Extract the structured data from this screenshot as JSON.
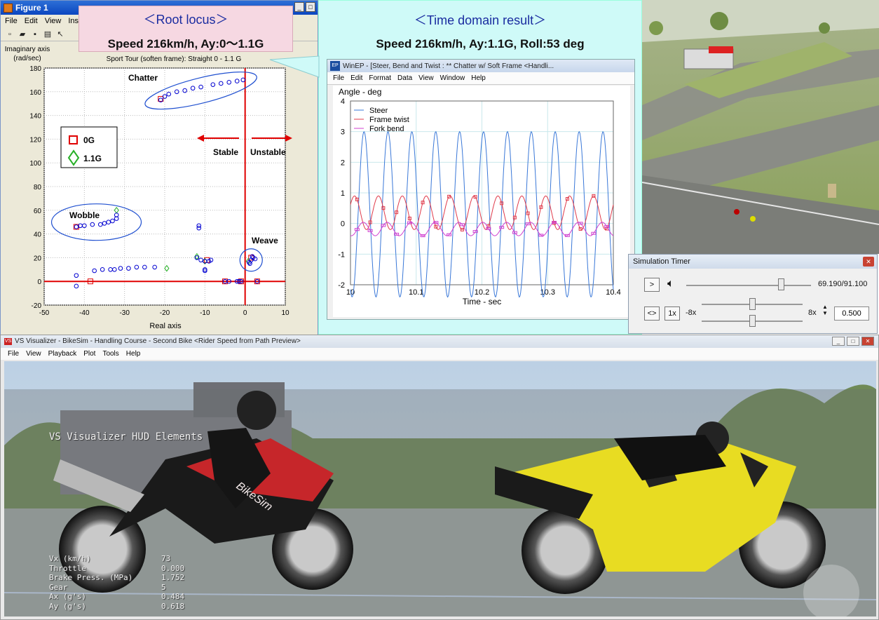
{
  "figure": {
    "title": "Figure 1",
    "menu": [
      "File",
      "Edit",
      "View",
      "Ins"
    ],
    "callout_title": "＜Root locus＞",
    "callout_sub": "Speed 216km/h, Ay:0～1.1G",
    "ylabel_line1": "Imaginary axis",
    "ylabel_line2": "(rad/sec)",
    "plot_title": "Sport Tour (soften frame): Straight 0 - 1.1 G",
    "xlabel": "Real axis",
    "legend": [
      "0G",
      "1.1G"
    ],
    "annotations": {
      "chatter": "Chatter",
      "wobble": "Wobble",
      "weave": "Weave",
      "stable": "Stable",
      "unstable": "Unstable"
    },
    "colors": {
      "mode0G": "#e00000",
      "mode11G": "#28b028",
      "poles": "#0000d0",
      "axis": "#e00000",
      "ellipse": "#2050d0"
    }
  },
  "time_domain": {
    "title": "＜Time domain result＞",
    "subtitle": "Speed 216km/h, Ay:1.1G, Roll:53 deg",
    "window_title": "WinEP - [Steer, Bend and Twist : ** Chatter w/ Soft Frame <Handli...",
    "menu": [
      "File",
      "Edit",
      "Format",
      "Data",
      "View",
      "Window",
      "Help"
    ],
    "ylabel": "Angle - deg",
    "xlabel": "Time - sec",
    "legend": [
      "Steer",
      "Frame twist",
      "Fork bend"
    ],
    "colors": {
      "steer": "#3a78d8",
      "twist": "#e03a4a",
      "fork": "#d040d0"
    }
  },
  "sim_timer": {
    "title": "Simulation Timer",
    "play_label": ">",
    "loop_label": "<>",
    "speed_label": "1x",
    "min_speed": "-8x",
    "max_speed": "8x",
    "time_readout": "69.190/91.100",
    "rate_value": "0.500",
    "time_progress": 0.7595,
    "speed_position": 0.5
  },
  "visualizer": {
    "title": "VS Visualizer - BikeSim - Handling Course - Second Bike <Rider Speed from Path Preview>",
    "menu": [
      "File",
      "View",
      "Playback",
      "Plot",
      "Tools",
      "Help"
    ],
    "hud_title": "VS Visualizer HUD Elements",
    "hud_rows": [
      {
        "label": "Vx (km/h)",
        "value": "73"
      },
      {
        "label": "Throttle",
        "value": "0.000"
      },
      {
        "label": "Brake Press. (MPa)",
        "value": "1.752"
      },
      {
        "label": "Gear",
        "value": "5"
      },
      {
        "label": "Ax (g's)",
        "value": "0.484"
      },
      {
        "label": "Ay (g's)",
        "value": "0.618"
      }
    ],
    "bike_brand": "BikeSim"
  },
  "chart_data": [
    {
      "type": "scatter",
      "title": "Sport Tour (soften frame): Straight 0 - 1.1 G",
      "xlabel": "Real axis",
      "ylabel": "Imaginary axis (rad/sec)",
      "xlim": [
        -50,
        10
      ],
      "ylim": [
        -20,
        180
      ],
      "xticks": [
        -50,
        -40,
        -30,
        -20,
        -10,
        0,
        10
      ],
      "yticks": [
        -20,
        0,
        20,
        40,
        60,
        80,
        100,
        120,
        140,
        160,
        180
      ],
      "grid": true,
      "legend_position": "left",
      "series": [
        {
          "name": "0G",
          "marker": "square",
          "points": [
            [
              -21,
              154
            ],
            [
              -42,
              46
            ],
            [
              -38.5,
              0
            ],
            [
              -5,
              0
            ],
            [
              -1,
              0
            ],
            [
              3,
              0
            ],
            [
              1.5,
              20
            ],
            [
              -9.5,
              18
            ]
          ]
        },
        {
          "name": "1.1G",
          "marker": "diamond",
          "points": [
            [
              -32,
              60
            ],
            [
              -19.5,
              11
            ],
            [
              -12,
              21
            ],
            [
              0.8,
              17
            ],
            [
              -10,
              17
            ]
          ]
        },
        {
          "name": "",
          "marker": "circle",
          "points": [
            [
              -21,
              153
            ],
            [
              -20,
              156
            ],
            [
              -19,
              158
            ],
            [
              -17,
              160
            ],
            [
              -15,
              161
            ],
            [
              -13,
              163
            ],
            [
              -11,
              164
            ],
            [
              -8,
              166
            ],
            [
              -6,
              167
            ],
            [
              -4,
              168
            ],
            [
              -2,
              169
            ],
            [
              -0.5,
              170
            ],
            [
              -42,
              46
            ],
            [
              -41,
              47
            ],
            [
              -40,
              47
            ],
            [
              -38,
              48
            ],
            [
              -36,
              48
            ],
            [
              -35,
              49
            ],
            [
              -34,
              50
            ],
            [
              -33,
              51
            ],
            [
              -32,
              53
            ],
            [
              -32,
              56
            ],
            [
              -42,
              5
            ],
            [
              -42,
              -4
            ],
            [
              -37.5,
              9
            ],
            [
              -35.5,
              10
            ],
            [
              -33.5,
              10
            ],
            [
              -32.5,
              10
            ],
            [
              -31,
              11
            ],
            [
              -29,
              11
            ],
            [
              -27,
              12
            ],
            [
              -25,
              12
            ],
            [
              -22.5,
              12
            ],
            [
              -11.5,
              47
            ],
            [
              -11.5,
              45
            ],
            [
              -12,
              20
            ],
            [
              -11,
              18
            ],
            [
              -10,
              17
            ],
            [
              -9,
              17
            ],
            [
              -8.5,
              18
            ],
            [
              -10,
              10
            ],
            [
              -10,
              9
            ],
            [
              1,
              16
            ],
            [
              1.5,
              18
            ],
            [
              2,
              20
            ],
            [
              2.5,
              19
            ],
            [
              1.2,
              15
            ],
            [
              1.8,
              21
            ],
            [
              -5,
              0
            ],
            [
              -4,
              0
            ],
            [
              -2,
              0
            ],
            [
              -1.5,
              0
            ],
            [
              -1,
              0
            ],
            [
              3,
              0
            ]
          ]
        }
      ]
    },
    {
      "type": "line",
      "xlabel": "Time - sec",
      "ylabel": "Angle - deg",
      "xlim": [
        10,
        10.4
      ],
      "ylim": [
        -2,
        4
      ],
      "xticks": [
        10,
        10.1,
        10.2,
        10.3,
        10.4
      ],
      "yticks": [
        -2,
        -1,
        0,
        1,
        2,
        3,
        4
      ],
      "grid": true,
      "legend_position": "top-left",
      "series": [
        {
          "name": "Steer",
          "amplitude": 2.7,
          "offset": 0.3,
          "frequency_hz": 27.5,
          "phase_rad": -2.0
        },
        {
          "name": "Frame twist",
          "amplitude": 0.55,
          "offset": 0.35,
          "frequency_hz": 27.5,
          "phase_rad": 0.5
        },
        {
          "name": "Fork bend",
          "amplitude": 0.22,
          "offset": -0.18,
          "frequency_hz": 27.5,
          "phase_rad": -1.8
        }
      ]
    }
  ]
}
